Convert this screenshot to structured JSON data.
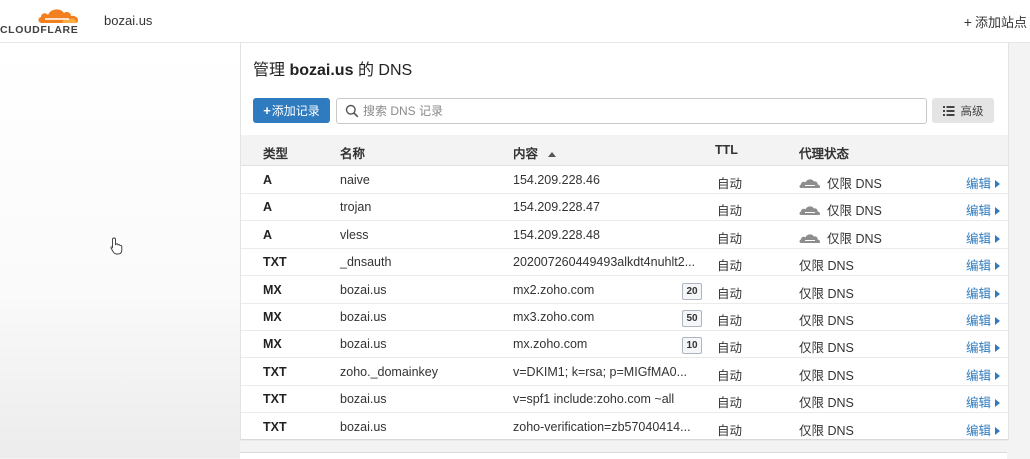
{
  "header": {
    "logo_text": "CLOUDFLARE",
    "site": "bozai.us",
    "add_site_label": "添加站点"
  },
  "page": {
    "title_prefix": "管理",
    "title_domain": "bozai.us",
    "title_suffix": "的 DNS"
  },
  "toolbar": {
    "add_record_label": "添加记录",
    "search_placeholder": "搜索 DNS 记录",
    "advanced_label": "高级"
  },
  "table": {
    "headers": {
      "type": "类型",
      "name": "名称",
      "content": "内容",
      "ttl": "TTL",
      "proxy": "代理状态"
    },
    "edit_label": "编辑",
    "rows": [
      {
        "type": "A",
        "name": "naive",
        "content": "154.209.228.46",
        "priority": "",
        "ttl": "自动",
        "proxy": "仅限 DNS"
      },
      {
        "type": "A",
        "name": "trojan",
        "content": "154.209.228.47",
        "priority": "",
        "ttl": "自动",
        "proxy": "仅限 DNS"
      },
      {
        "type": "A",
        "name": "vless",
        "content": "154.209.228.48",
        "priority": "",
        "ttl": "自动",
        "proxy": "仅限 DNS"
      },
      {
        "type": "TXT",
        "name": "_dnsauth",
        "content": "202007260449493alkdt4nuhlt2...",
        "priority": "",
        "ttl": "自动",
        "proxy": "仅限 DNS"
      },
      {
        "type": "MX",
        "name": "bozai.us",
        "content": "mx2.zoho.com",
        "priority": "20",
        "ttl": "自动",
        "proxy": "仅限 DNS"
      },
      {
        "type": "MX",
        "name": "bozai.us",
        "content": "mx3.zoho.com",
        "priority": "50",
        "ttl": "自动",
        "proxy": "仅限 DNS"
      },
      {
        "type": "MX",
        "name": "bozai.us",
        "content": "mx.zoho.com",
        "priority": "10",
        "ttl": "自动",
        "proxy": "仅限 DNS"
      },
      {
        "type": "TXT",
        "name": "zoho._domainkey",
        "content": "v=DKIM1; k=rsa; p=MIGfMA0...",
        "priority": "",
        "ttl": "自动",
        "proxy": "仅限 DNS"
      },
      {
        "type": "TXT",
        "name": "bozai.us",
        "content": "v=spf1 include:zoho.com ~all",
        "priority": "",
        "ttl": "自动",
        "proxy": "仅限 DNS"
      },
      {
        "type": "TXT",
        "name": "bozai.us",
        "content": "zoho-verification=zb57040414...",
        "priority": "",
        "ttl": "自动",
        "proxy": "仅限 DNS"
      }
    ]
  },
  "colors": {
    "brand_orange": "#f38020",
    "link_blue": "#2f7bbf",
    "proxy_cloud_gray": "#8d8d8d"
  },
  "icons": {
    "logo": "cloudflare-cloud-icon",
    "search": "search-icon",
    "advanced": "list-icon",
    "sort": "sort-asc-icon",
    "proxy": "dns-only-cloud-icon",
    "edit": "chevron-right-icon"
  }
}
